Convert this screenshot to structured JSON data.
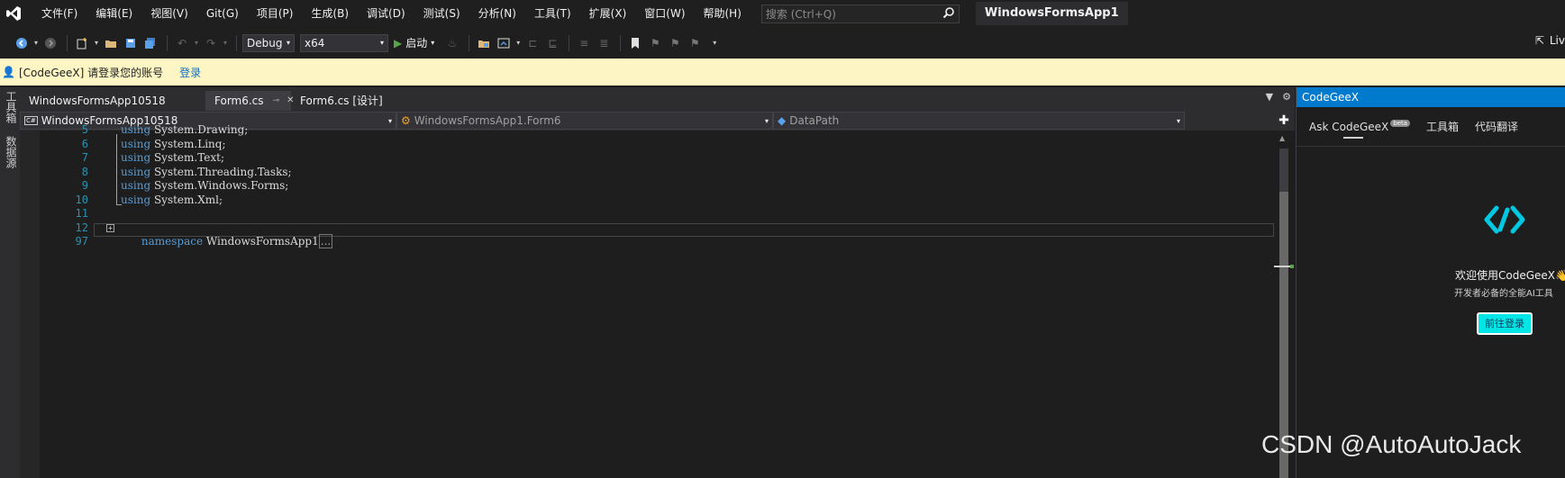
{
  "menubar": {
    "items": [
      "文件(F)",
      "编辑(E)",
      "视图(V)",
      "Git(G)",
      "项目(P)",
      "生成(B)",
      "调试(D)",
      "测试(S)",
      "分析(N)",
      "工具(T)",
      "扩展(X)",
      "窗口(W)",
      "帮助(H)"
    ],
    "search_placeholder": "搜索 (Ctrl+Q)",
    "app_title": "WindowsFormsApp1"
  },
  "toolbar": {
    "config": "Debug",
    "platform": "x64",
    "start_label": "启动",
    "live_label": "Liv"
  },
  "infobar": {
    "message": "[CodeGeeX] 请登录您的账号",
    "login_link": "登录"
  },
  "side_strip": {
    "tabs": [
      "工具箱",
      "数据源"
    ]
  },
  "doc_tabs": {
    "items": [
      "WindowsFormsApp10518",
      "Form6.cs",
      "Form6.cs [设计]"
    ],
    "pin_icon": "⊸",
    "close_icon": "✕"
  },
  "navbar": {
    "project": "WindowsFormsApp10518",
    "class": "WindowsFormsApp1.Form6",
    "member": "DataPath",
    "project_badge": "C#"
  },
  "editor": {
    "lines": [
      {
        "num": "5",
        "kw": "using",
        "rest": " System.Drawing;"
      },
      {
        "num": "6",
        "kw": "using",
        "rest": " System.Linq;"
      },
      {
        "num": "7",
        "kw": "using",
        "rest": " System.Text;"
      },
      {
        "num": "8",
        "kw": "using",
        "rest": " System.Threading.Tasks;"
      },
      {
        "num": "9",
        "kw": "using",
        "rest": " System.Windows.Forms;"
      },
      {
        "num": "10",
        "kw": "using",
        "rest": " System.Xml;"
      },
      {
        "num": "11",
        "kw": "",
        "rest": ""
      },
      {
        "num": "12",
        "kw": "namespace",
        "rest": " WindowsFormsApp1"
      },
      {
        "num": "97",
        "kw": "",
        "rest": ""
      }
    ],
    "collapsed_text": "...",
    "fold_symbol": "+"
  },
  "rpanel": {
    "title": "CodeGeeX",
    "tabs": [
      "Ask CodeGeeX",
      "工具箱",
      "代码翻译"
    ],
    "beta_badge": "beta",
    "welcome_title": "欢迎使用CodeGeeX👋",
    "welcome_sub": "开发者必备的全能AI工具",
    "login_button": "前往登录"
  },
  "watermark": "CSDN @AutoAutoJack"
}
